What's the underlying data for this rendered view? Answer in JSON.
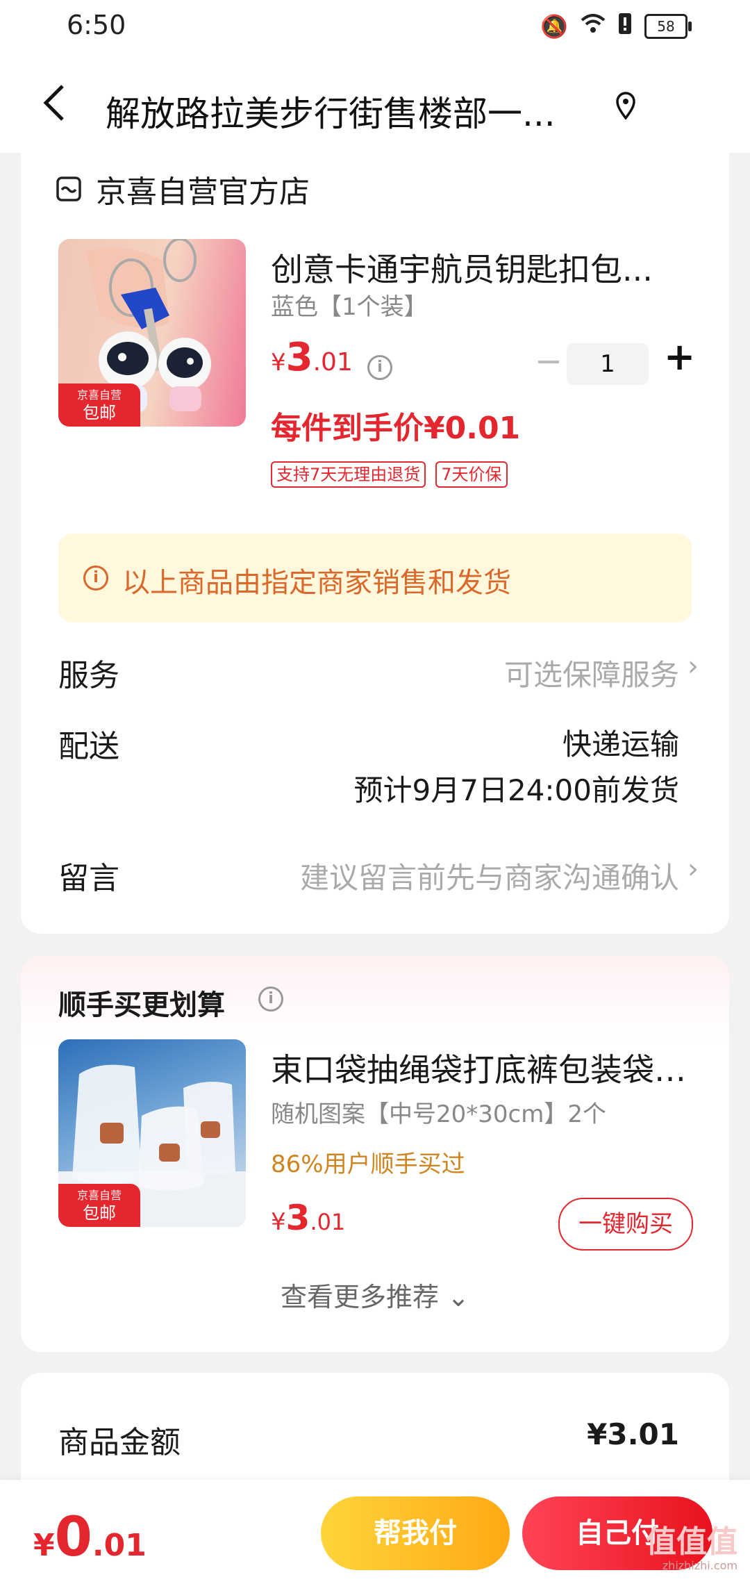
{
  "status_bar": {
    "time": "6:50",
    "battery": "58"
  },
  "header": {
    "title": "解放路拉美步行街售楼部一..."
  },
  "store": {
    "name": "京喜自营官方店"
  },
  "product": {
    "title": "创意卡通宇航员钥匙扣包...",
    "spec": "蓝色【1个装】",
    "price_yen": "¥",
    "price_int": "3",
    "price_dec": ".01",
    "quantity": "1",
    "net_price": "每件到手价¥0.01",
    "tags": [
      "支持7天无理由退货",
      "7天价保"
    ],
    "badge_line1": "京喜自营",
    "badge_line2": "包邮"
  },
  "notice": {
    "text": "以上商品由指定商家销售和发货"
  },
  "rows": {
    "service_label": "服务",
    "service_value": "可选保障服务",
    "delivery_label": "配送",
    "delivery_value": "快递运输",
    "delivery_eta": "预计9月7日24:00前发货",
    "message_label": "留言",
    "message_placeholder": "建议留言前先与商家沟通确认"
  },
  "addon": {
    "section_title": "顺手买更划算",
    "title": "束口袋抽绳袋打底裤包装袋内...",
    "spec": "随机图案【中号20*30cm】2个",
    "social_proof": "86%用户顺手买过",
    "price_yen": "¥",
    "price_int": "3",
    "price_dec": ".01",
    "buy_button": "一键购买",
    "more": "查看更多推荐",
    "badge_line1": "京喜自营",
    "badge_line2": "包邮"
  },
  "summary": {
    "label": "商品金额",
    "value": "¥3.01"
  },
  "bottom": {
    "total_yen": "¥",
    "total_int": "0",
    "total_dec": ".01",
    "help_pay": "帮我付",
    "self_pay": "自己付"
  },
  "watermark": {
    "brand": "值值值",
    "site": "zhizhizhi.com"
  },
  "colors": {
    "accent_red": "#e4262e",
    "notice_bg": "#fff8dc",
    "notice_text": "#d9682a",
    "help_yellow": "#ffb81f"
  }
}
